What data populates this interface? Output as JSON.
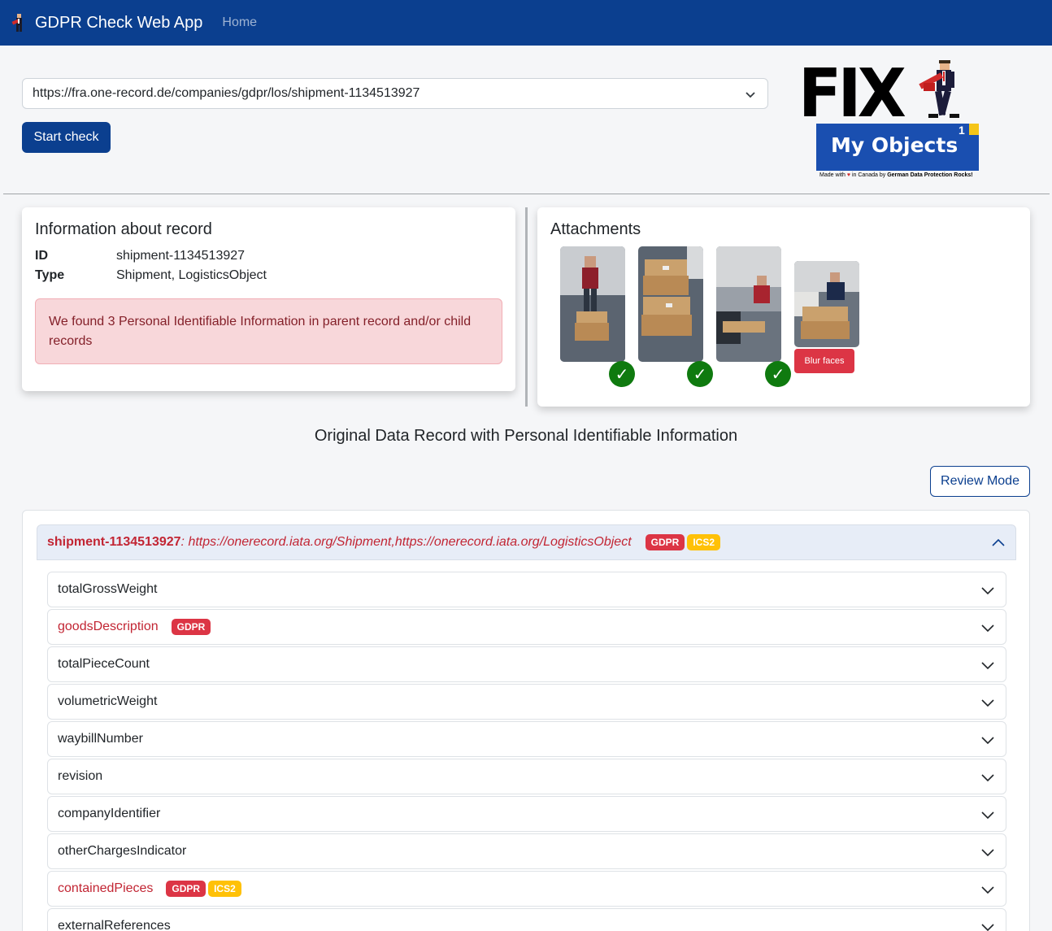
{
  "navbar": {
    "brand": "GDPR Check Web App",
    "home": "Home"
  },
  "form": {
    "selected_url": "https://fra.one-record.de/companies/gdpr/los/shipment-1134513927",
    "start_label": "Start check"
  },
  "logo": {
    "fix": "FIX",
    "objects": "My Objects",
    "superscript": "1",
    "tagline_prefix": "Made with",
    "tagline_heart": "♥",
    "tagline_mid": "in Canada by",
    "tagline_bold": "German Data Protection Rocks!"
  },
  "info": {
    "title": "Information about record",
    "id_label": "ID",
    "id_value": "shipment-1134513927",
    "type_label": "Type",
    "type_value": "Shipment, LogisticsObject",
    "alert": "We found 3 Personal Identifiable Information in parent record and/or child records"
  },
  "attachments": {
    "title": "Attachments",
    "blur_label": "Blur faces",
    "items": [
      {
        "status": "ok"
      },
      {
        "status": "ok"
      },
      {
        "status": "ok"
      },
      {
        "status": "blur"
      }
    ]
  },
  "record": {
    "section_title": "Original Data Record with Personal Identifiable Information",
    "review_label": "Review Mode",
    "head_id": "shipment-1134513927",
    "head_sep": ":",
    "head_types": "https://onerecord.iata.org/Shipment,https://onerecord.iata.org/LogisticsObject",
    "head_badges": [
      "GDPR",
      "ICS2"
    ],
    "fields": [
      {
        "label": "totalGrossWeight",
        "badges": []
      },
      {
        "label": "goodsDescription",
        "badges": [
          "GDPR"
        ]
      },
      {
        "label": "totalPieceCount",
        "badges": []
      },
      {
        "label": "volumetricWeight",
        "badges": []
      },
      {
        "label": "waybillNumber",
        "badges": []
      },
      {
        "label": "revision",
        "badges": []
      },
      {
        "label": "companyIdentifier",
        "badges": []
      },
      {
        "label": "otherChargesIndicator",
        "badges": []
      },
      {
        "label": "containedPieces",
        "badges": [
          "GDPR",
          "ICS2"
        ]
      },
      {
        "label": "externalReferences",
        "badges": []
      }
    ]
  },
  "colors": {
    "navbar": "#0b3f8f",
    "pii_text": "#c22533",
    "gdpr_badge": "#dc3545",
    "ics2_badge": "#ffc107",
    "check": "#0f7a0f"
  }
}
